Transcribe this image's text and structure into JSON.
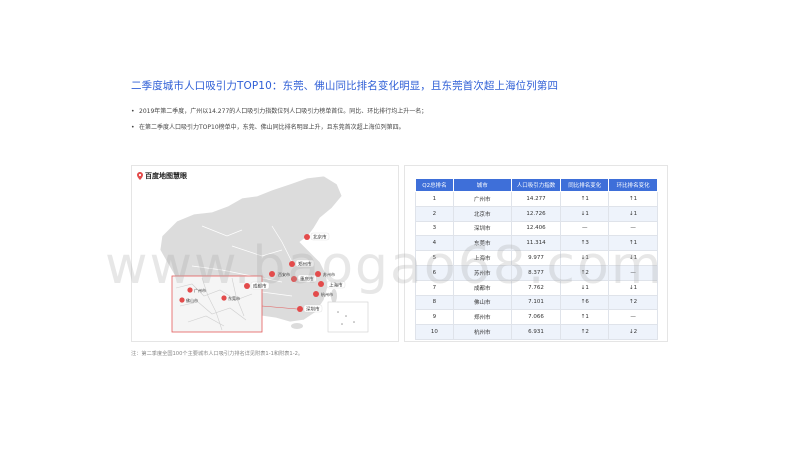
{
  "title": "二季度城市人口吸引力TOP10：东莞、佛山同比排名变化明显，且东莞首次超上海位列第四",
  "bullets": [
    "2019年第二季度，广州以14.277的人口吸引力指数位列人口吸引力榜单首位。同比、环比排行均上升一名；",
    "在第二季度人口吸引力TOP10榜单中，东莞、佛山同比排名明显上升，且东莞首次超上海位列第四。"
  ],
  "map": {
    "logo_text": "百度地图慧眼",
    "labels": [
      "北京市",
      "郑州市",
      "西安市",
      "成都市",
      "重庆市",
      "苏州市",
      "上海市",
      "杭州市",
      "深圳市",
      "广州市",
      "东莞市",
      "佛山市"
    ]
  },
  "table": {
    "headers": [
      "Q2总排名",
      "城市",
      "人口吸引力指数",
      "同比排名变化",
      "环比排名变化"
    ],
    "rows": [
      {
        "rank": "1",
        "city": "广州市",
        "index": "14.277",
        "yoy": "↑1",
        "yoy_dir": "up",
        "qoq": "↑1",
        "qoq_dir": "up"
      },
      {
        "rank": "2",
        "city": "北京市",
        "index": "12.726",
        "yoy": "↓1",
        "yoy_dir": "down",
        "qoq": "↓1",
        "qoq_dir": "down"
      },
      {
        "rank": "3",
        "city": "深圳市",
        "index": "12.406",
        "yoy": "—",
        "yoy_dir": "none",
        "qoq": "—",
        "qoq_dir": "none"
      },
      {
        "rank": "4",
        "city": "东莞市",
        "index": "11.314",
        "yoy": "↑3",
        "yoy_dir": "up",
        "qoq": "↑1",
        "qoq_dir": "up",
        "highlight": true
      },
      {
        "rank": "5",
        "city": "上海市",
        "index": "9.977",
        "yoy": "↓1",
        "yoy_dir": "down",
        "qoq": "↓1",
        "qoq_dir": "down"
      },
      {
        "rank": "6",
        "city": "苏州市",
        "index": "8.377",
        "yoy": "↑2",
        "yoy_dir": "up",
        "qoq": "—",
        "qoq_dir": "none"
      },
      {
        "rank": "7",
        "city": "成都市",
        "index": "7.762",
        "yoy": "↓1",
        "yoy_dir": "down",
        "qoq": "↓1",
        "qoq_dir": "down"
      },
      {
        "rank": "8",
        "city": "佛山市",
        "index": "7.101",
        "yoy": "↑6",
        "yoy_dir": "up",
        "qoq": "↑2",
        "qoq_dir": "up"
      },
      {
        "rank": "9",
        "city": "郑州市",
        "index": "7.066",
        "yoy": "↑1",
        "yoy_dir": "up",
        "qoq": "—",
        "qoq_dir": "none"
      },
      {
        "rank": "10",
        "city": "杭州市",
        "index": "6.931",
        "yoy": "↑2",
        "yoy_dir": "up",
        "qoq": "↓2",
        "qoq_dir": "down"
      }
    ]
  },
  "note": "注：第二季度全国100个主要城市人口吸引力排名详见附表1-1和附表1-2。",
  "watermark": "www.baogao68.com",
  "colors": {
    "accent": "#2f5fd6",
    "header_bg": "#3e6fd9",
    "up": "#e34b4b",
    "down": "#2aa84a"
  }
}
